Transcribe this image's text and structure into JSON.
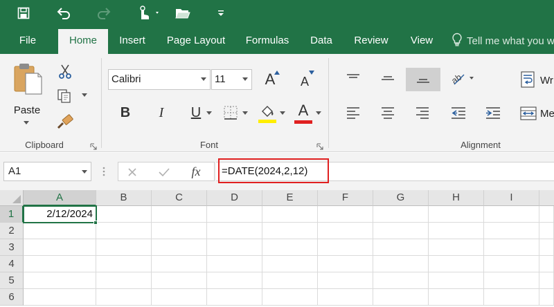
{
  "ribbon_tabs": [
    {
      "label": "File",
      "active": false
    },
    {
      "label": "Home",
      "active": true
    },
    {
      "label": "Insert",
      "active": false
    },
    {
      "label": "Page Layout",
      "active": false
    },
    {
      "label": "Formulas",
      "active": false
    },
    {
      "label": "Data",
      "active": false
    },
    {
      "label": "Review",
      "active": false
    },
    {
      "label": "View",
      "active": false
    }
  ],
  "tell_me": "Tell me what you w",
  "clipboard": {
    "paste_label": "Paste",
    "group_label": "Clipboard"
  },
  "font": {
    "name": "Calibri",
    "size": "11",
    "group_label": "Font",
    "bold": "B",
    "italic": "I",
    "underline": "U",
    "font_color_letter": "A",
    "grow_letter": "A",
    "shrink_letter": "A"
  },
  "alignment": {
    "group_label": "Alignment",
    "wrap_label": "Wr",
    "merge_label": "Me"
  },
  "formula_bar": {
    "name_box": "A1",
    "fx": "fx",
    "formula": "=DATE(2024,2,12)"
  },
  "sheet": {
    "columns": [
      "A",
      "B",
      "C",
      "D",
      "E",
      "F",
      "G",
      "H",
      "I"
    ],
    "rows": [
      "1",
      "2",
      "3",
      "4",
      "5",
      "6"
    ],
    "active_cell": "A1",
    "cell_A1": "2/12/2024"
  },
  "colors": {
    "brand": "#217346",
    "highlight_box": "#e02020",
    "fill_color_bar": "#ffee00",
    "font_color_bar": "#e02020"
  },
  "icons": {
    "save": "save-icon",
    "undo": "undo-icon",
    "redo": "redo-icon",
    "touch_mode": "touch-mode-icon",
    "open": "open-folder-icon",
    "customize": "customize-qat-icon",
    "lightbulb": "lightbulb-icon",
    "cut": "scissors-icon",
    "copy": "copy-icon",
    "format_painter": "format-painter-icon",
    "borders": "borders-icon",
    "fill_color": "fill-bucket-icon",
    "orientation": "orientation-icon",
    "indent_decrease": "decrease-indent-icon",
    "indent_increase": "increase-indent-icon",
    "cancel": "cancel-icon",
    "enter": "check-icon"
  }
}
